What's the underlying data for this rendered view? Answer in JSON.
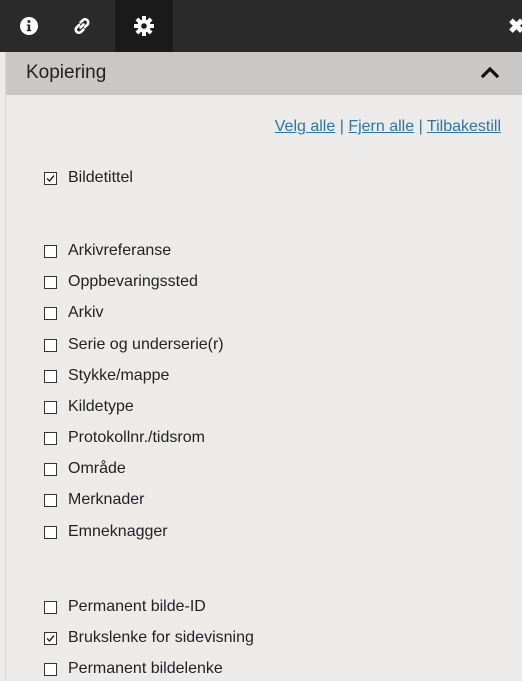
{
  "tabs": [
    {
      "name": "info",
      "icon": "info-icon",
      "active": false
    },
    {
      "name": "link",
      "icon": "link-icon",
      "active": false
    },
    {
      "name": "settings",
      "icon": "gear-icon",
      "active": true
    }
  ],
  "panel": {
    "title": "Kopiering",
    "actions": {
      "select_all": "Velg alle",
      "remove_all": "Fjern alle",
      "reset": "Tilbakestill",
      "separator": "|"
    },
    "groups": [
      [
        {
          "label": "Bildetittel",
          "checked": true
        }
      ],
      [
        {
          "label": "Arkivreferanse",
          "checked": false
        },
        {
          "label": "Oppbevaringssted",
          "checked": false
        },
        {
          "label": "Arkiv",
          "checked": false
        },
        {
          "label": "Serie og underserie(r)",
          "checked": false
        },
        {
          "label": "Stykke/mappe",
          "checked": false
        },
        {
          "label": "Kildetype",
          "checked": false
        },
        {
          "label": "Protokollnr./tidsrom",
          "checked": false
        },
        {
          "label": "Område",
          "checked": false
        },
        {
          "label": "Merknader",
          "checked": false
        },
        {
          "label": "Emneknagger",
          "checked": false
        }
      ],
      [
        {
          "label": "Permanent bilde-ID",
          "checked": false
        },
        {
          "label": "Brukslenke for sidevisning",
          "checked": true
        },
        {
          "label": "Permanent bildelenke",
          "checked": false
        }
      ]
    ]
  },
  "colors": {
    "topbar": "#2b2b2b",
    "active_tab": "#1a1a1a",
    "panel_bg": "#ecebea",
    "header_bg": "#c9c8c7",
    "link": "#2a78a8"
  }
}
